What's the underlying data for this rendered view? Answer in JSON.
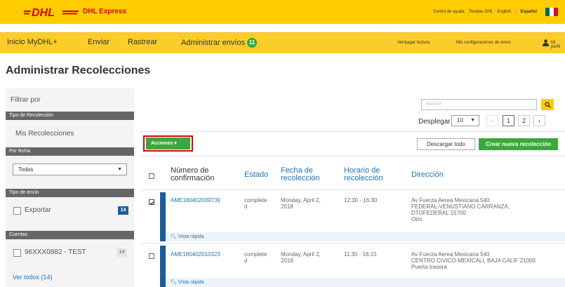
{
  "brand": {
    "logo_text": "DHL",
    "product": "DHL Express"
  },
  "top_links": {
    "help": "Centro de ayuda",
    "stores": "Tiendas DHL",
    "english": "English",
    "spanish": "Español"
  },
  "nav": {
    "home": "Inicio MyDHL+",
    "send": "Enviar",
    "track": "Rastrear",
    "manage": "Administrar envíos",
    "manage_count": "11",
    "pay_invoice": "Ver/pagar factura",
    "settings": "Mis configuraciones de envío",
    "profile": "Mi perfil"
  },
  "page": {
    "title": "Administrar Recolecciones"
  },
  "sidebar": {
    "filter_title": "Filtrar por",
    "section_type": "Tipo de Recolección",
    "my_pickups": "Mis Recolecciones",
    "section_date": "Por fecha",
    "date_value": "Todas",
    "section_ship_type": "Tipo de envío",
    "export_label": "Exportar",
    "export_count": "14",
    "section_accounts": "Cuentas",
    "account_label": "96XXX0882 - TEST",
    "account_count": "14",
    "see_all": "Ver todos (14)"
  },
  "toolbar": {
    "search_placeholder": "Buscar",
    "display_label": "Desplegar",
    "per_page": "10",
    "page_prev": "‹",
    "page_1": "1",
    "page_2": "2",
    "page_next": "›",
    "actions": "Acciones ▾",
    "download_all": "Descargar todo",
    "create_new": "Crear nueva recolección"
  },
  "table": {
    "headers": {
      "confirmation": "Número de confirmación",
      "status": "Estado",
      "date": "Fecha de recolección",
      "time": "Horario de recolección",
      "address": "Dirección"
    },
    "rows": [
      {
        "confirmation": "AME180402009739",
        "status": "complete d",
        "date": "Monday, April 2, 2018",
        "time": "12:30 - 16:30",
        "address_line1": "Av Fuerza Aerea Mexicana 540",
        "address_line2": "FEDERAL-VENUSTIANO CARRANZA,",
        "address_line3": "DTOFEDERAL 15700",
        "address_line4": "Otro",
        "quick_view": "Vista rápida",
        "checked": true
      },
      {
        "confirmation": "AME180402010323",
        "status": "complete d",
        "date": "Monday, April 2, 2018",
        "time": "11:30 - 16:15",
        "address_line1": "Av Fuerza Aerea Mexicana 540",
        "address_line2": "CENTRO CIVICO-MEXICALI, BAJA CALIF 21000",
        "address_line3": "Puerta trasera",
        "address_line4": "",
        "quick_view": "Vista rápida",
        "checked": false
      }
    ]
  },
  "colors": {
    "dhl_yellow": "#ffcc00",
    "dhl_red": "#d40511",
    "action_green": "#3aa83c",
    "link_blue": "#1a74b8",
    "row_accent": "#1e5c99"
  }
}
